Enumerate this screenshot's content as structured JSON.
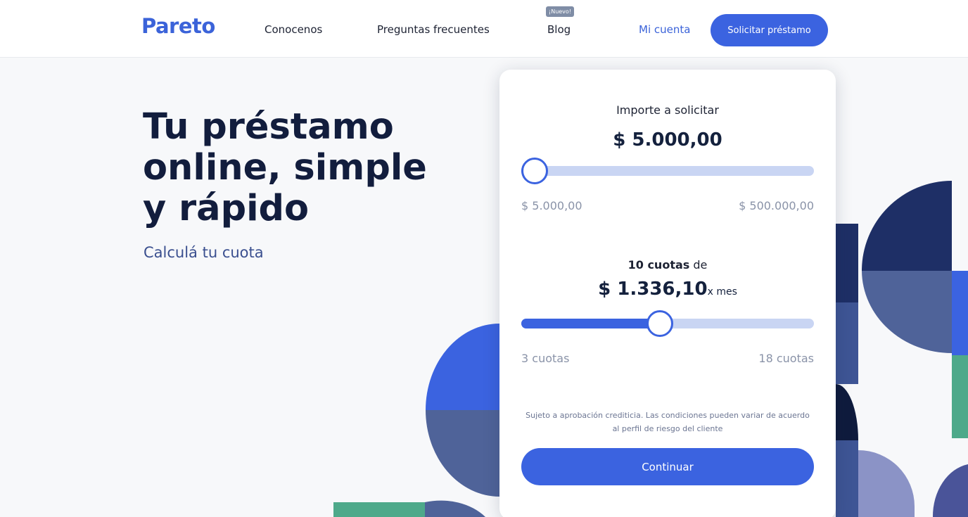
{
  "header": {
    "logo": "Pareto",
    "nav": [
      {
        "label": "Conocenos"
      },
      {
        "label": "Preguntas frecuentes"
      },
      {
        "label": "Blog",
        "badge": "¡Nuevo!"
      }
    ],
    "account_label": "Mi cuenta",
    "cta_label": "Solicitar préstamo"
  },
  "hero": {
    "title": "Tu préstamo online, simple y rápido",
    "subtitle": "Calculá tu cuota"
  },
  "calculator": {
    "amount_label": "Importe a solicitar",
    "amount_value": "$ 5.000,00",
    "amount_min": "$ 5.000,00",
    "amount_max": "$ 500.000,00",
    "amount_fraction": 0.0,
    "cuotas_count": "10 cuotas",
    "cuotas_suffix": "de",
    "cuota_value": "$ 1.336,10",
    "cuota_unit": "x mes",
    "cuotas_min": "3 cuotas",
    "cuotas_max": "18 cuotas",
    "cuotas_fraction": 0.47,
    "disclaimer": "Sujeto a aprobación crediticia. Las condiciones pueden variar de acuerdo al perfil de riesgo del cliente",
    "continue_label": "Continuar"
  },
  "colors": {
    "brand_blue": "#3b63e0",
    "navy": "#14213d",
    "slate": "#4f6399",
    "green": "#4ea98a",
    "track": "#c9d5f3"
  }
}
